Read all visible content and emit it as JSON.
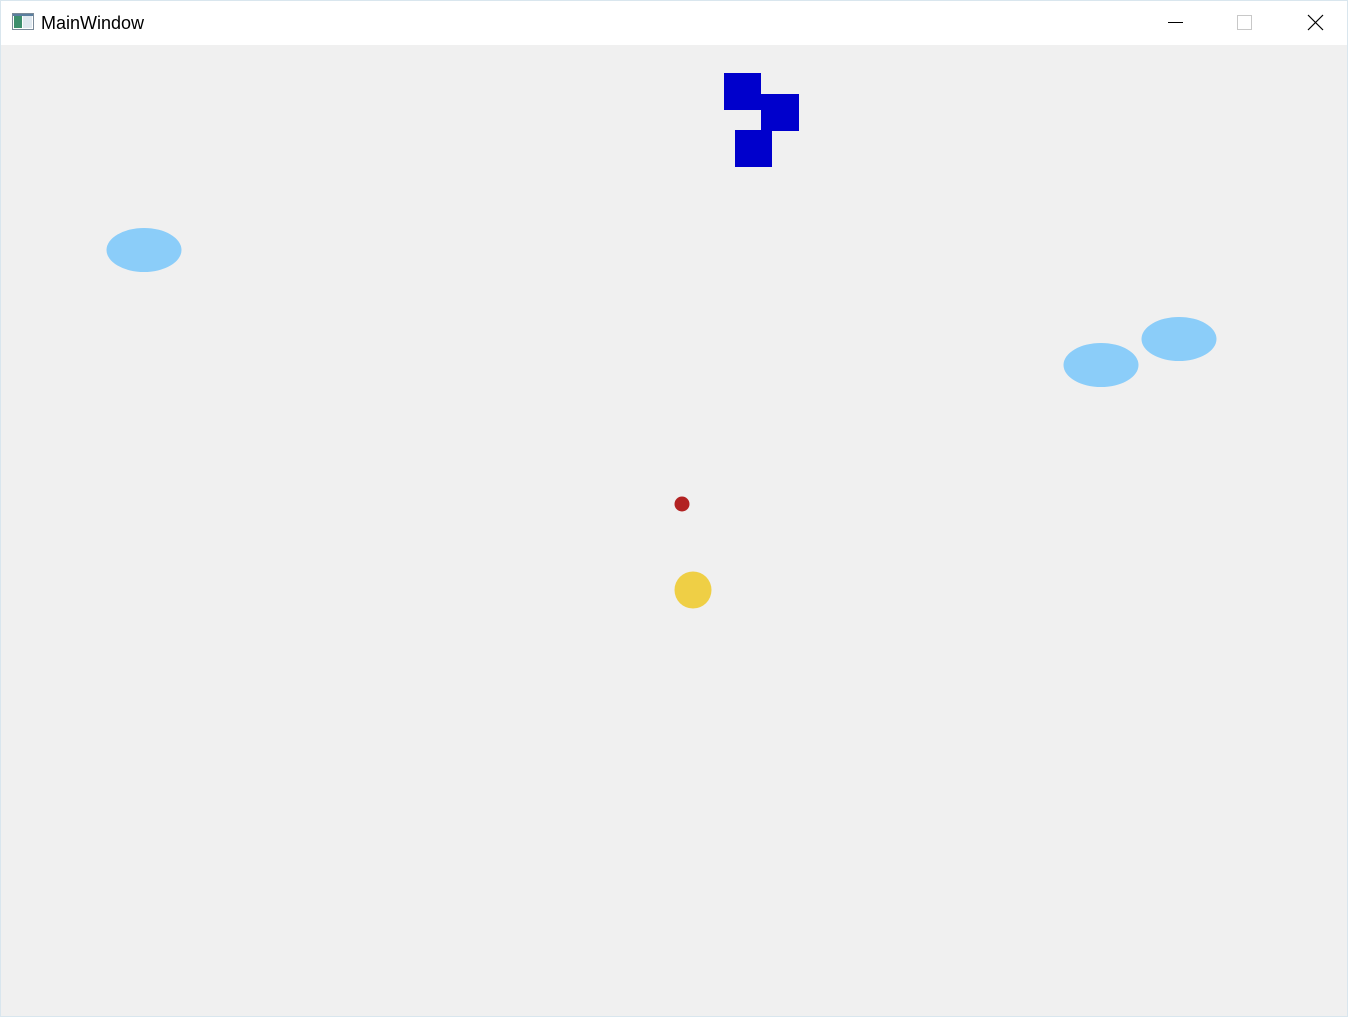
{
  "window": {
    "title": "MainWindow",
    "controls": {
      "minimize": "minimize-icon",
      "maximize": "maximize-icon",
      "close": "close-icon"
    }
  },
  "game": {
    "background_color": "#f0f0f0",
    "player_ship": {
      "color": "#0000cc",
      "shape": "block-ship"
    },
    "enemies": [
      {
        "color": "#8bcdf9",
        "shape": "ellipse"
      },
      {
        "color": "#8bcdf9",
        "shape": "ellipse"
      },
      {
        "color": "#8bcdf9",
        "shape": "ellipse"
      }
    ],
    "projectile": {
      "color": "#b22222",
      "shape": "circle"
    },
    "coin": {
      "color": "#efcf45",
      "shape": "circle"
    }
  }
}
